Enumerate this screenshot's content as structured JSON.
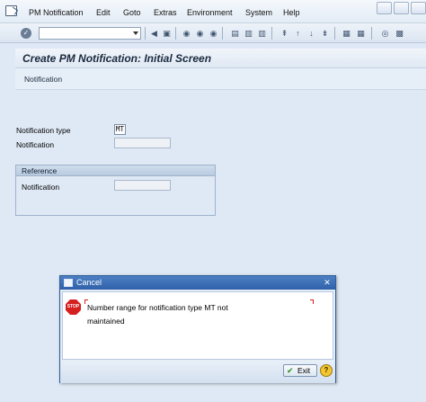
{
  "menu": {
    "items": [
      "PM Notification",
      "Edit",
      "Goto",
      "Extras",
      "Environment",
      "System",
      "Help"
    ]
  },
  "toolbar": {
    "command_field_value": "",
    "icons": [
      "enter-icon",
      "save-icon",
      "back-icon",
      "exit-icon",
      "cancel-icon",
      "print-icon",
      "find-icon",
      "find-next-icon",
      "first-page-icon",
      "previous-page-icon",
      "next-page-icon",
      "last-page-icon",
      "new-session-icon",
      "shortcut-icon",
      "help-icon",
      "customize-layout-icon"
    ]
  },
  "page": {
    "title": "Create PM Notification: Initial Screen",
    "app_toolbar_button": "Notification"
  },
  "form": {
    "notification_type_label": "Notification type",
    "notification_type_value": "MT",
    "notification_label": "Notification",
    "notification_value": ""
  },
  "reference": {
    "title": "Reference",
    "notification_label": "Notification",
    "notification_value": ""
  },
  "dialog": {
    "title": "Cancel",
    "close_glyph": "✕",
    "stop_label": "STOP",
    "message_line1": "Number range for notification type MT not",
    "message_line2": "maintained",
    "exit_label": "Exit",
    "check_glyph": "✔",
    "help_glyph": "?"
  },
  "colors": {
    "background": "#dfe9f5",
    "dialog_titlebar": "#2e61a8",
    "stop_red": "#d61f1f",
    "help_yellow": "#f2c531"
  }
}
